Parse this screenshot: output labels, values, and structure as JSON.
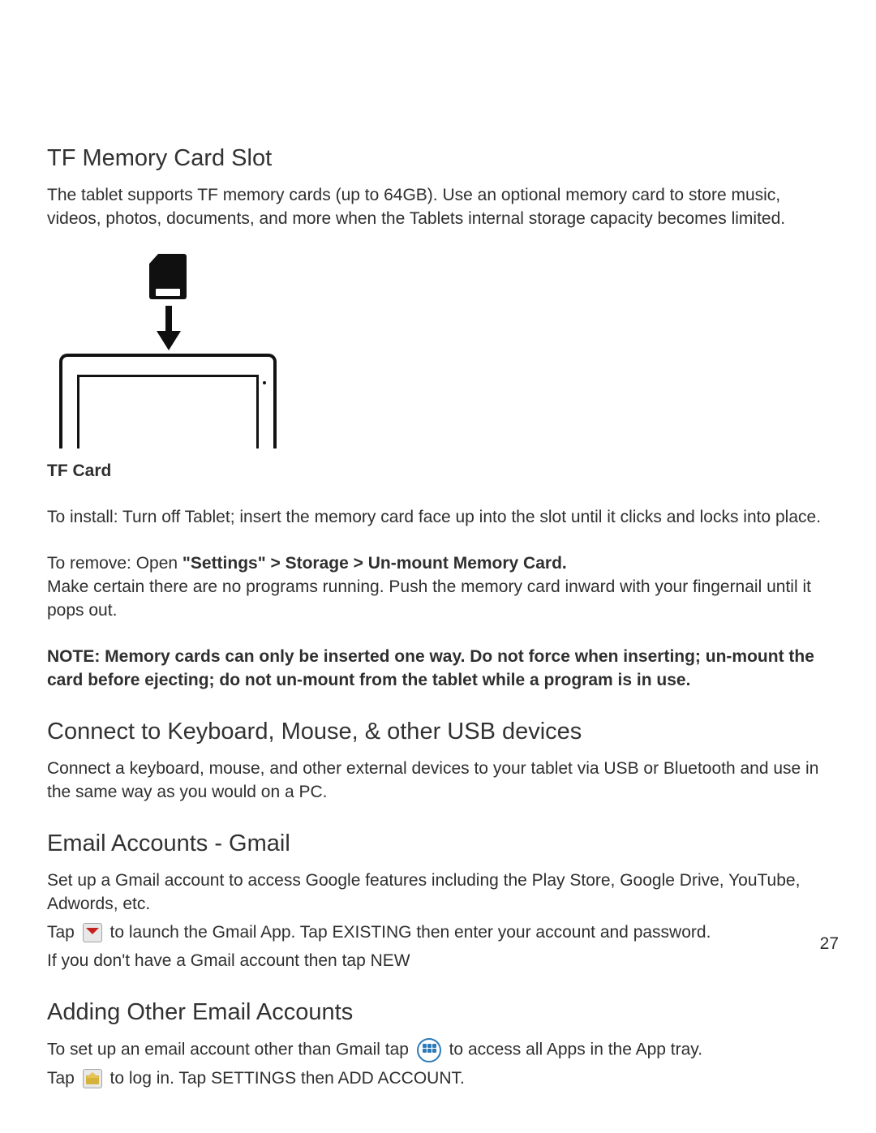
{
  "tf_slot": {
    "heading": "TF Memory Card Slot",
    "intro": "The tablet supports TF memory cards (up to 64GB). Use an optional memory card to store music, videos, photos, documents, and more when the Tablets internal storage capacity becomes limited.",
    "subhead": "TF Card",
    "install": "To install: Turn off Tablet; insert the memory card face up into the slot until it clicks and locks into place.",
    "remove_lead": "To remove: Open ",
    "remove_bold": "\"Settings\" > Storage > Un-mount Memory Card.",
    "remove_body": "Make certain there are no programs running. Push the memory card inward with your fingernail until it pops out.",
    "note": "NOTE: Memory cards can only be inserted one way. Do not force when inserting; un-mount the card before ejecting; do not un-mount from the tablet while a program is in use."
  },
  "usb": {
    "heading": "Connect to Keyboard, Mouse, & other USB devices",
    "body": "Connect a keyboard, mouse, and other external devices to your tablet via USB or Bluetooth and use in the same way as you would on a PC."
  },
  "gmail": {
    "heading": "Email Accounts - Gmail",
    "intro": "Set up a Gmail account to access Google features including the Play Store, Google Drive, YouTube, Adwords, etc.",
    "tap_pre": "Tap ",
    "tap_post": " to launch the Gmail App. Tap EXISTING then enter your account and password.",
    "no_account": "If you don't have a Gmail account then tap NEW"
  },
  "other_email": {
    "heading": "Adding Other Email Accounts",
    "line1_pre": "To set up an email account other than Gmail tap ",
    "line1_post": " to access all Apps in the App tray.",
    "line2_pre": "Tap ",
    "line2_post": " to log in. Tap SETTINGS then ADD ACCOUNT."
  },
  "page_number": "27"
}
